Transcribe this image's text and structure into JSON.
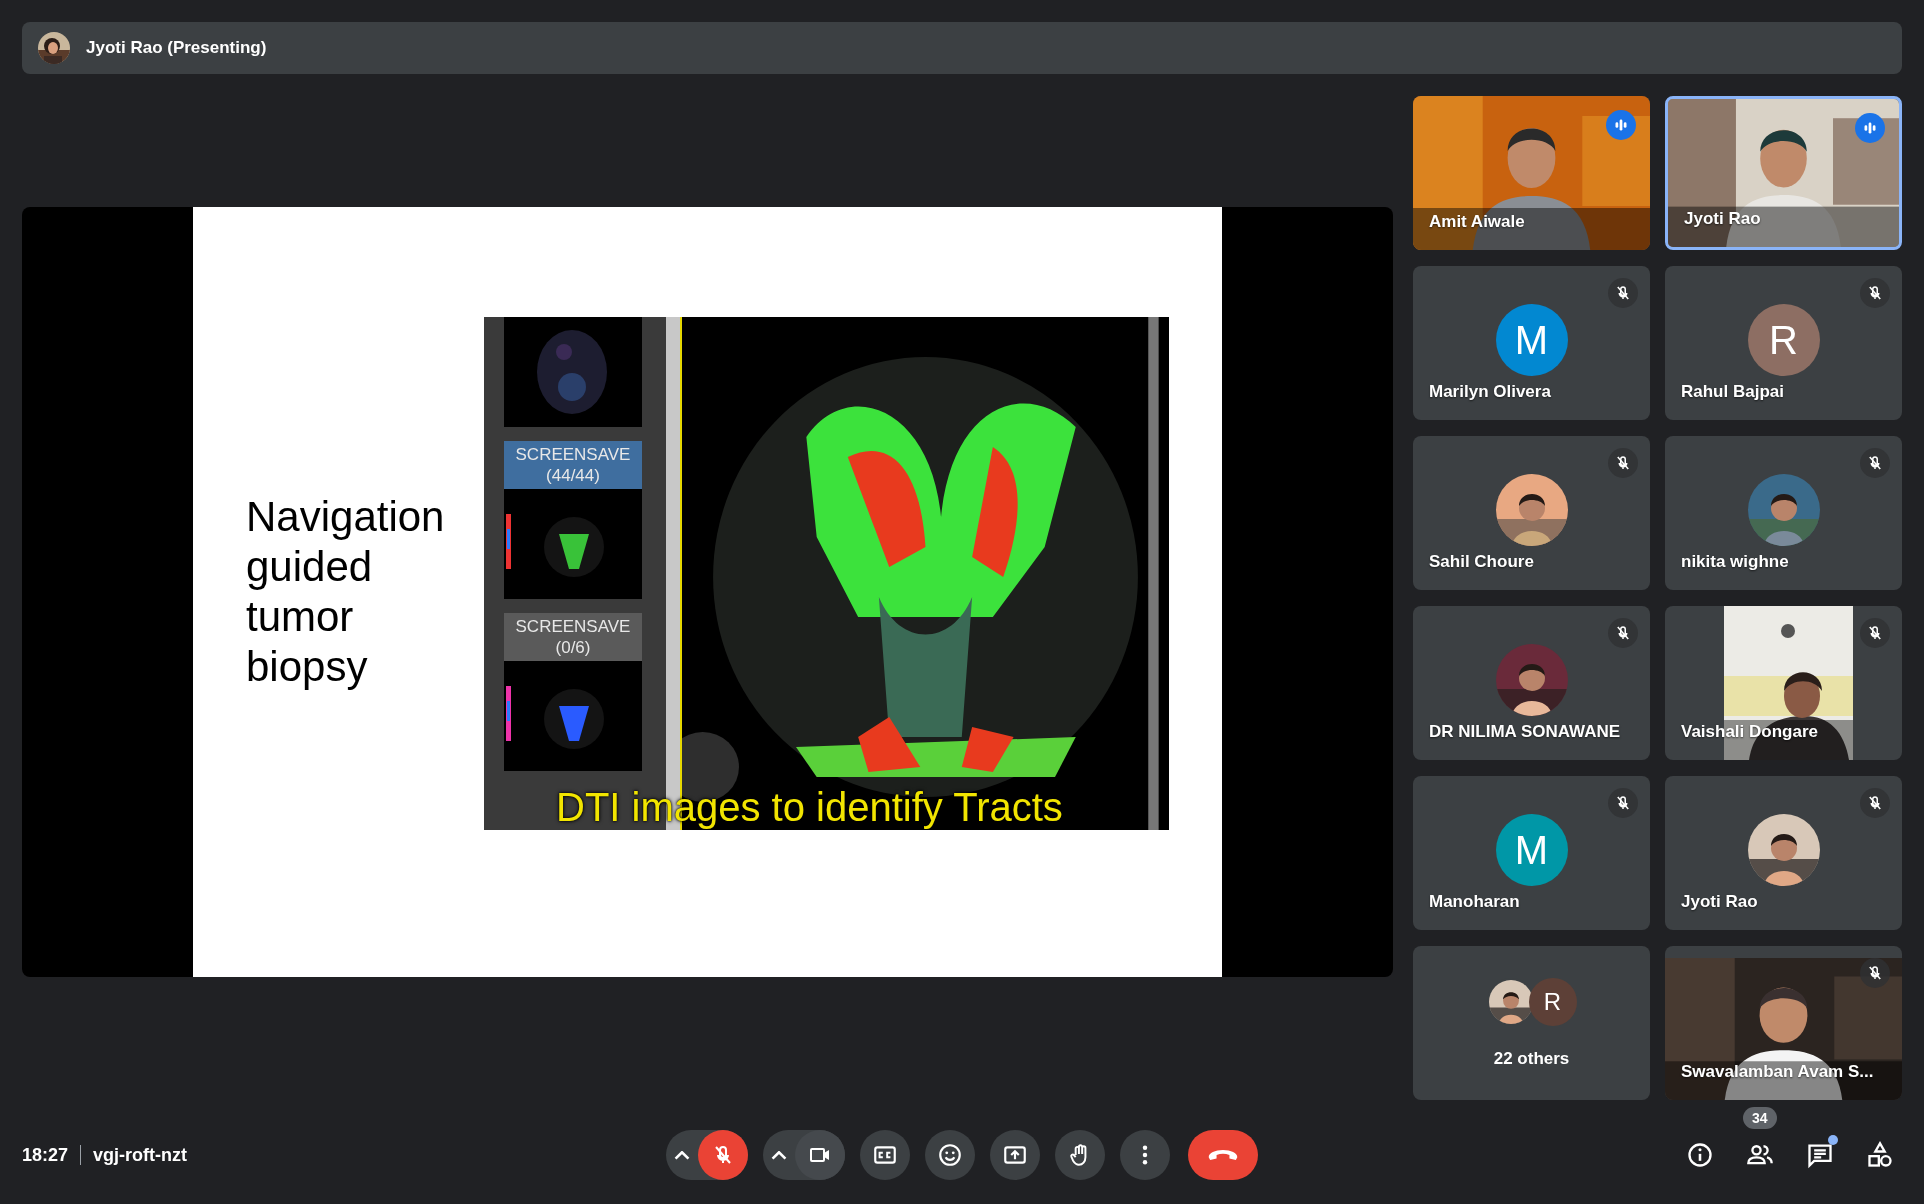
{
  "presenter_bar": {
    "name": "Jyoti Rao (Presenting)"
  },
  "slide": {
    "title": "Navigation guided tumor biopsy",
    "screenshot": {
      "thumbnails": [
        {
          "label": "SCREENSAVE (44/44)",
          "selected": true
        },
        {
          "label": "SCREENSAVE (0/6)",
          "selected": false
        }
      ],
      "caption": "DTI images to identify Tracts"
    }
  },
  "participants": [
    {
      "name": "Amit Aiwale",
      "kind": "video",
      "speaking": true,
      "muted": false,
      "selected": false
    },
    {
      "name": "Jyoti Rao",
      "kind": "video",
      "speaking": true,
      "muted": false,
      "selected": true
    },
    {
      "name": "Marilyn Olivera",
      "kind": "initial",
      "initial": "M",
      "color": "#0288d1",
      "speaking": false,
      "muted": true,
      "selected": false
    },
    {
      "name": "Rahul Bajpai",
      "kind": "initial",
      "initial": "R",
      "color": "#8d6e63",
      "speaking": false,
      "muted": true,
      "selected": false
    },
    {
      "name": "Sahil Choure",
      "speaking": false,
      "muted": true,
      "selected": false
    },
    {
      "name": "nikita wighne",
      "speaking": false,
      "muted": true,
      "selected": false
    },
    {
      "name": "DR NILIMA SONAWANE",
      "speaking": false,
      "muted": true,
      "selected": false
    },
    {
      "name": "Vaishali Dongare",
      "kind": "narrow_video",
      "speaking": false,
      "muted": true,
      "selected": false
    },
    {
      "name": "Manoharan",
      "kind": "initial",
      "initial": "M",
      "color": "#0097a7",
      "speaking": false,
      "muted": true,
      "selected": false
    },
    {
      "name": "Jyoti Rao",
      "speaking": false,
      "muted": true,
      "selected": false
    },
    {
      "kind": "others",
      "initial": "R",
      "color": "#5d4037",
      "label": "22 others"
    },
    {
      "name": "Swavalamban Avam S...",
      "kind": "video",
      "speaking": false,
      "muted": true,
      "selected": false
    }
  ],
  "footer": {
    "time": "18:27",
    "meeting_code": "vgj-roft-nzt"
  },
  "controls": [
    {
      "kind": "mic",
      "on": false
    },
    {
      "kind": "camera",
      "on": true
    },
    {
      "kind": "captions"
    },
    {
      "kind": "emoji"
    },
    {
      "kind": "present"
    },
    {
      "kind": "hand"
    },
    {
      "kind": "more"
    },
    {
      "kind": "end"
    }
  ],
  "side_controls": [
    {
      "kind": "info"
    },
    {
      "kind": "people",
      "badge": "34"
    },
    {
      "kind": "chat",
      "unread": true
    },
    {
      "kind": "activities"
    }
  ]
}
